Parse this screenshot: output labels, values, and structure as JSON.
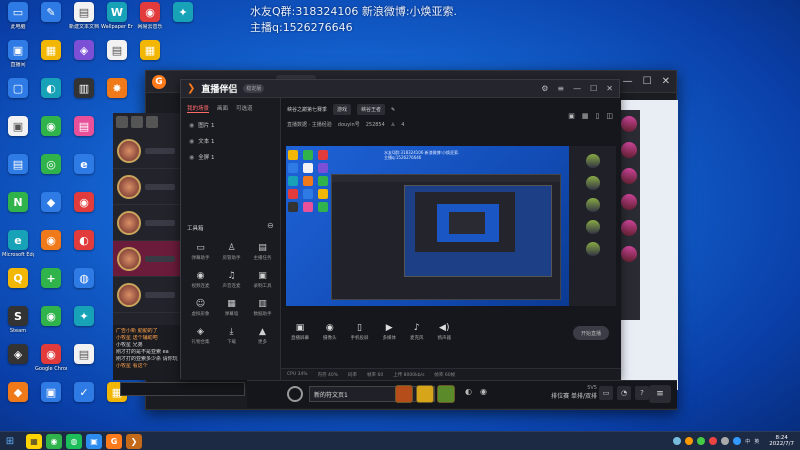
{
  "overlay": {
    "line1": "水友Q群:318324106 新浪微博:小焕亚索.",
    "line2": "主播q:1526276646"
  },
  "desktop_icons": [
    {
      "label": "此电脑",
      "glyph": "▭",
      "color": "c-blue",
      "icon": "computer-icon"
    },
    {
      "label": "",
      "glyph": "✎",
      "color": "c-blue",
      "icon": "app-icon"
    },
    {
      "label": "新建文本文档",
      "glyph": "▤",
      "color": "c-wht",
      "icon": "text-file-icon"
    },
    {
      "label": "Wallpaper Engine",
      "glyph": "W",
      "color": "c-teal",
      "icon": "wallpaper-icon"
    },
    {
      "label": "网易云音乐",
      "glyph": "◉",
      "color": "c-red",
      "icon": "music-icon"
    },
    {
      "label": "",
      "glyph": "✦",
      "color": "c-teal",
      "icon": "app-icon"
    },
    {
      "label": "直播间",
      "glyph": "▣",
      "color": "c-blue",
      "icon": "folder-icon"
    },
    {
      "label": "",
      "glyph": "▦",
      "color": "c-yel",
      "icon": "folder-icon"
    },
    {
      "label": "",
      "glyph": "◈",
      "color": "c-pur",
      "icon": "app-icon"
    },
    {
      "label": "",
      "glyph": "▤",
      "color": "c-wht",
      "icon": "text-file-icon"
    },
    {
      "label": "",
      "glyph": "▦",
      "color": "c-yel",
      "icon": "folder-icon"
    },
    {
      "label": "",
      "glyph": "",
      "color": "",
      "icon": "empty"
    },
    {
      "label": "",
      "glyph": "▢",
      "color": "c-blue",
      "icon": "app-icon"
    },
    {
      "label": "",
      "glyph": "◐",
      "color": "c-teal",
      "icon": "app-icon"
    },
    {
      "label": "",
      "glyph": "▥",
      "color": "c-dark",
      "icon": "app-icon"
    },
    {
      "label": "",
      "glyph": "✸",
      "color": "c-org",
      "icon": "app-icon"
    },
    {
      "label": "",
      "glyph": "",
      "color": "",
      "icon": "empty"
    },
    {
      "label": "",
      "glyph": "",
      "color": "",
      "icon": "empty"
    },
    {
      "label": "",
      "glyph": "▣",
      "color": "c-wht",
      "icon": "app-icon"
    },
    {
      "label": "",
      "glyph": "◉",
      "color": "c-green",
      "icon": "wechat-icon"
    },
    {
      "label": "",
      "glyph": "▤",
      "color": "c-pink",
      "icon": "app-icon"
    },
    {
      "label": "",
      "glyph": "",
      "color": "",
      "icon": "empty"
    },
    {
      "label": "",
      "glyph": "",
      "color": "",
      "icon": "empty"
    },
    {
      "label": "",
      "glyph": "",
      "color": "",
      "icon": "empty"
    },
    {
      "label": "",
      "glyph": "▤",
      "color": "c-blue",
      "icon": "app-icon"
    },
    {
      "label": "",
      "glyph": "◎",
      "color": "c-green",
      "icon": "app-icon"
    },
    {
      "label": "",
      "glyph": "e",
      "color": "c-blue",
      "icon": "browser-icon"
    },
    {
      "label": "",
      "glyph": "",
      "color": "",
      "icon": "empty"
    },
    {
      "label": "",
      "glyph": "",
      "color": "",
      "icon": "empty"
    },
    {
      "label": "",
      "glyph": "",
      "color": "",
      "icon": "empty"
    },
    {
      "label": "",
      "glyph": "N",
      "color": "c-green",
      "icon": "nvidia-icon"
    },
    {
      "label": "",
      "glyph": "◆",
      "color": "c-blue",
      "icon": "app-icon"
    },
    {
      "label": "",
      "glyph": "◉",
      "color": "c-red",
      "icon": "app-icon"
    },
    {
      "label": "",
      "glyph": "",
      "color": "",
      "icon": "empty"
    },
    {
      "label": "",
      "glyph": "",
      "color": "",
      "icon": "empty"
    },
    {
      "label": "",
      "glyph": "",
      "color": "",
      "icon": "empty"
    },
    {
      "label": "Microsoft Edge",
      "glyph": "e",
      "color": "c-teal",
      "icon": "edge-icon"
    },
    {
      "label": "",
      "glyph": "◉",
      "color": "c-org",
      "icon": "app-icon"
    },
    {
      "label": "",
      "glyph": "◐",
      "color": "c-red",
      "icon": "qq-icon"
    },
    {
      "label": "",
      "glyph": "",
      "color": "",
      "icon": "empty"
    },
    {
      "label": "",
      "glyph": "",
      "color": "",
      "icon": "empty"
    },
    {
      "label": "",
      "glyph": "",
      "color": "",
      "icon": "empty"
    },
    {
      "label": "",
      "glyph": "Q",
      "color": "c-yel",
      "icon": "app-icon"
    },
    {
      "label": "",
      "glyph": "+",
      "color": "c-green",
      "icon": "app-icon"
    },
    {
      "label": "",
      "glyph": "◍",
      "color": "c-blue",
      "icon": "app-icon"
    },
    {
      "label": "",
      "glyph": "",
      "color": "",
      "icon": "empty"
    },
    {
      "label": "",
      "glyph": "",
      "color": "",
      "icon": "empty"
    },
    {
      "label": "",
      "glyph": "",
      "color": "",
      "icon": "empty"
    },
    {
      "label": "Steam",
      "glyph": "S",
      "color": "c-dark",
      "icon": "steam-icon"
    },
    {
      "label": "",
      "glyph": "◉",
      "color": "c-green",
      "icon": "app-icon"
    },
    {
      "label": "",
      "glyph": "✦",
      "color": "c-teal",
      "icon": "app-icon"
    },
    {
      "label": "",
      "glyph": "",
      "color": "",
      "icon": "empty"
    },
    {
      "label": "",
      "glyph": "",
      "color": "",
      "icon": "empty"
    },
    {
      "label": "",
      "glyph": "",
      "color": "",
      "icon": "empty"
    },
    {
      "label": "",
      "glyph": "◈",
      "color": "c-dark",
      "icon": "app-icon"
    },
    {
      "label": "Google Chrome",
      "glyph": "◉",
      "color": "c-red",
      "icon": "chrome-icon"
    },
    {
      "label": "",
      "glyph": "▤",
      "color": "c-wht",
      "icon": "text-file-icon"
    },
    {
      "label": "",
      "glyph": "",
      "color": "",
      "icon": "empty"
    },
    {
      "label": "",
      "glyph": "",
      "color": "",
      "icon": "empty"
    },
    {
      "label": "",
      "glyph": "",
      "color": "",
      "icon": "empty"
    },
    {
      "label": "",
      "glyph": "◆",
      "color": "c-org",
      "icon": "app-icon"
    },
    {
      "label": "",
      "glyph": "▣",
      "color": "c-blue",
      "icon": "app-icon"
    },
    {
      "label": "",
      "glyph": "✓",
      "color": "c-blue",
      "icon": "app-icon"
    },
    {
      "label": "",
      "glyph": "▦",
      "color": "c-yel",
      "icon": "folder-icon"
    }
  ],
  "front_window": {
    "logo": "直播伴侣",
    "badge": "稳定版",
    "tabs": [
      "我的场景",
      "画面",
      "可选道"
    ],
    "scenes": [
      "图片 1",
      "文本 1",
      "全屏 1"
    ],
    "tools_title": "工具箱",
    "tools": [
      {
        "label": "弹幕助手",
        "glyph": "▭",
        "icon": "danmaku-icon"
      },
      {
        "label": "房管助手",
        "glyph": "♙",
        "icon": "admin-icon"
      },
      {
        "label": "主播任务",
        "glyph": "▤",
        "icon": "task-icon"
      },
      {
        "label": "视频连麦",
        "glyph": "◉",
        "icon": "video-link-icon"
      },
      {
        "label": "声音连麦",
        "glyph": "♫",
        "icon": "audio-link-icon"
      },
      {
        "label": "录制工具",
        "glyph": "▣",
        "icon": "record-icon"
      },
      {
        "label": "虚拟形象",
        "glyph": "☺",
        "icon": "avatar-icon"
      },
      {
        "label": "弹幕墙",
        "glyph": "▦",
        "icon": "danmaku-wall-icon"
      },
      {
        "label": "数据助手",
        "glyph": "▥",
        "icon": "data-icon"
      },
      {
        "label": "礼物合集",
        "glyph": "◈",
        "icon": "gift-icon"
      },
      {
        "label": "下载",
        "glyph": "⤓",
        "icon": "download-icon"
      },
      {
        "label": "更多",
        "glyph": "▲",
        "icon": "more-icon"
      }
    ],
    "title_chip1": "峡谷之巅第七赛季",
    "title_chip2": "游戏",
    "title_chip3": "峡谷王者",
    "info1": "直播数据 · 主播经验",
    "info2": "douyin号",
    "info3": "252854",
    "info4": "4",
    "bottom_tools": [
      {
        "label": "直播屏幕",
        "glyph": "▣",
        "icon": "screen-icon"
      },
      {
        "label": "摄像头",
        "glyph": "◉",
        "icon": "camera-icon"
      },
      {
        "label": "手机投屏",
        "glyph": "▯",
        "icon": "phone-cast-icon"
      },
      {
        "label": "多媒体",
        "glyph": "▶",
        "icon": "media-icon"
      },
      {
        "label": "麦克风",
        "glyph": "♪",
        "icon": "mic-icon"
      },
      {
        "label": "扬声器",
        "glyph": "◀)",
        "icon": "speaker-icon"
      }
    ],
    "start_live": "开始直播",
    "status": [
      "CPU 34%",
      "内存 40%",
      "码率",
      "帧率 60",
      "上传 8000kb/s",
      "帧率 60帧"
    ]
  },
  "chat": [
    {
      "text": "广告小新 勤勤的了",
      "kind": "sys"
    },
    {
      "text": "小牧星 送个辅助吧",
      "kind": "sys"
    },
    {
      "text": "小牧星 兄弟",
      "kind": "u"
    },
    {
      "text": "刚才打的是不是亚索 ea",
      "kind": "u"
    },
    {
      "text": "刚才打的亚索多少杀 请你玩",
      "kind": "u"
    },
    {
      "text": "小牧星 看这个",
      "kind": "sys"
    }
  ],
  "game_bar": {
    "dropdown": "新的符文页1",
    "rank_top": "5V5",
    "rank_bottom": "排位赛 单排/双排",
    "menu": "≡"
  },
  "taskbar": {
    "time": "8:24",
    "date": "2022/7/7",
    "ime": "中",
    "lang": "英"
  },
  "colors": {
    "desktop": "#1466d3",
    "window_bg": "#1f2026",
    "accent": "#ff6b6b"
  }
}
